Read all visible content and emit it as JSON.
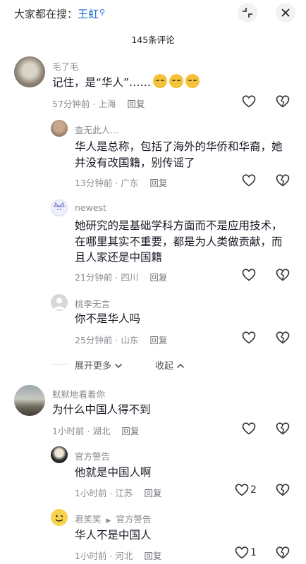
{
  "header": {
    "search_prefix": "大家都在搜：",
    "search_keyword": "王虹",
    "comment_count_title": "145条评论"
  },
  "comments": [
    {
      "user": "毛了毛",
      "text": "记住，是“华人”……",
      "meta": "57分钟前 · 上海",
      "reply": "回复",
      "likes": ""
    },
    {
      "user": "查无此人...",
      "lines": [
        "华人是总称，包括了海外的华侨和华裔，她",
        "并没有改国籍，别传谣了"
      ],
      "meta": "13分钟前 · 广东",
      "reply": "回复",
      "likes": ""
    },
    {
      "user": "newest",
      "lines": [
        "她研究的是基础学科方面而不是应用技术，",
        "在哪里其实不重要，都是为人类做贡献，而",
        "且人家还是中国籍"
      ],
      "meta": "21分钟前 · 四川",
      "reply": "回复",
      "likes": ""
    },
    {
      "user": "桃李无言",
      "text": "你不是华人吗",
      "meta": "25分钟前 · 山东",
      "reply": "回复",
      "likes": ""
    },
    {
      "user": "默默地看着你",
      "text": "为什么中国人得不到",
      "meta": "1小时前 · 湖北",
      "reply": "回复",
      "likes": ""
    },
    {
      "user": "官方警告",
      "text": "他就是中国人啊",
      "meta": "1小时前 · 江苏",
      "reply": "回复",
      "likes": "2"
    },
    {
      "user": "君笑笑",
      "reply_to": "官方警告",
      "text": "华人不是中国人",
      "meta": "1小时前 · 河北",
      "reply": "回复",
      "likes": "1"
    }
  ],
  "expand": {
    "more": "展开更多",
    "collapse": "收起"
  },
  "icons": [
    "close-icon",
    "collapse-icon",
    "search-icon",
    "heart-icon",
    "dislike-icon",
    "chevron-down-icon",
    "chevron-up-icon",
    "reply-arrow-icon"
  ]
}
